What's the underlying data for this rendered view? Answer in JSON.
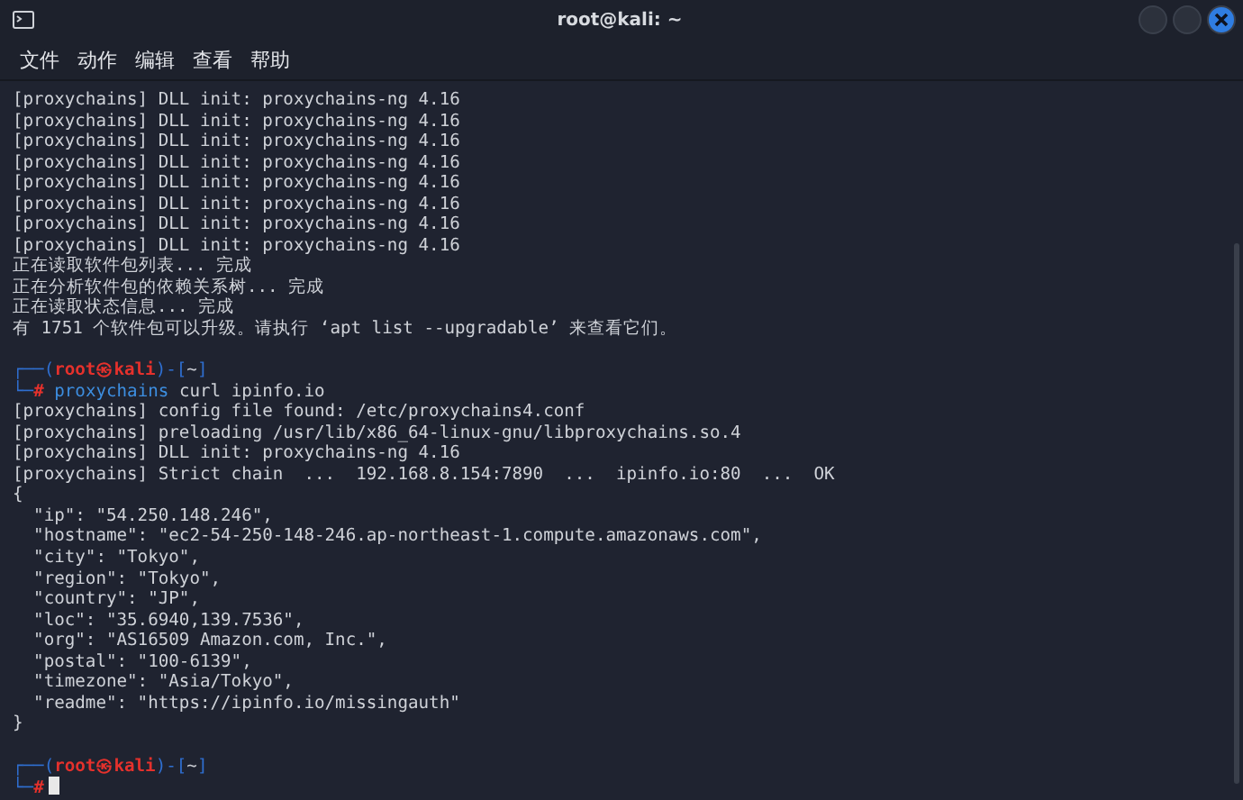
{
  "window": {
    "title": "root@kali: ~"
  },
  "menu": [
    "文件",
    "动作",
    "编辑",
    "查看",
    "帮助"
  ],
  "lines": [
    {
      "kind": "output",
      "text": "[proxychains] DLL init: proxychains-ng 4.16"
    },
    {
      "kind": "output",
      "text": "[proxychains] DLL init: proxychains-ng 4.16"
    },
    {
      "kind": "output",
      "text": "[proxychains] DLL init: proxychains-ng 4.16"
    },
    {
      "kind": "output",
      "text": "[proxychains] DLL init: proxychains-ng 4.16"
    },
    {
      "kind": "output",
      "text": "[proxychains] DLL init: proxychains-ng 4.16"
    },
    {
      "kind": "output",
      "text": "[proxychains] DLL init: proxychains-ng 4.16"
    },
    {
      "kind": "output",
      "text": "[proxychains] DLL init: proxychains-ng 4.16"
    },
    {
      "kind": "output",
      "text": "[proxychains] DLL init: proxychains-ng 4.16"
    },
    {
      "kind": "output",
      "text": "正在读取软件包列表... 完成"
    },
    {
      "kind": "output",
      "text": "正在分析软件包的依赖关系树... 完成"
    },
    {
      "kind": "output",
      "text": "正在读取状态信息... 完成"
    },
    {
      "kind": "output",
      "text": "有 1751 个软件包可以升级。请执行 ‘apt list --upgradable’ 来查看它们。"
    },
    {
      "kind": "blank"
    },
    {
      "kind": "prompt",
      "frame_left": "┌──(",
      "user_host": "root㉿kali",
      "mid": ")-[",
      "dir": "~",
      "frame_right": "]"
    },
    {
      "kind": "command",
      "corner": "└─",
      "symbol": "#",
      "program": "proxychains",
      "args": "curl ipinfo.io",
      "cursor": false
    },
    {
      "kind": "output",
      "text": "[proxychains] config file found: /etc/proxychains4.conf"
    },
    {
      "kind": "output",
      "text": "[proxychains] preloading /usr/lib/x86_64-linux-gnu/libproxychains.so.4"
    },
    {
      "kind": "output",
      "text": "[proxychains] DLL init: proxychains-ng 4.16"
    },
    {
      "kind": "output",
      "text": "[proxychains] Strict chain  ...  192.168.8.154:7890  ...  ipinfo.io:80  ...  OK"
    },
    {
      "kind": "output",
      "text": "{"
    },
    {
      "kind": "output",
      "text": "  \"ip\": \"54.250.148.246\","
    },
    {
      "kind": "output",
      "text": "  \"hostname\": \"ec2-54-250-148-246.ap-northeast-1.compute.amazonaws.com\","
    },
    {
      "kind": "output",
      "text": "  \"city\": \"Tokyo\","
    },
    {
      "kind": "output",
      "text": "  \"region\": \"Tokyo\","
    },
    {
      "kind": "output",
      "text": "  \"country\": \"JP\","
    },
    {
      "kind": "output",
      "text": "  \"loc\": \"35.6940,139.7536\","
    },
    {
      "kind": "output",
      "text": "  \"org\": \"AS16509 Amazon.com, Inc.\","
    },
    {
      "kind": "output",
      "text": "  \"postal\": \"100-6139\","
    },
    {
      "kind": "output",
      "text": "  \"timezone\": \"Asia/Tokyo\","
    },
    {
      "kind": "output",
      "text": "  \"readme\": \"https://ipinfo.io/missingauth\""
    },
    {
      "kind": "output",
      "text": "}"
    },
    {
      "kind": "blank"
    },
    {
      "kind": "prompt",
      "frame_left": "┌──(",
      "user_host": "root㉿kali",
      "mid": ")-[",
      "dir": "~",
      "frame_right": "]"
    },
    {
      "kind": "command",
      "corner": "└─",
      "symbol": "#",
      "cursor": true
    }
  ]
}
